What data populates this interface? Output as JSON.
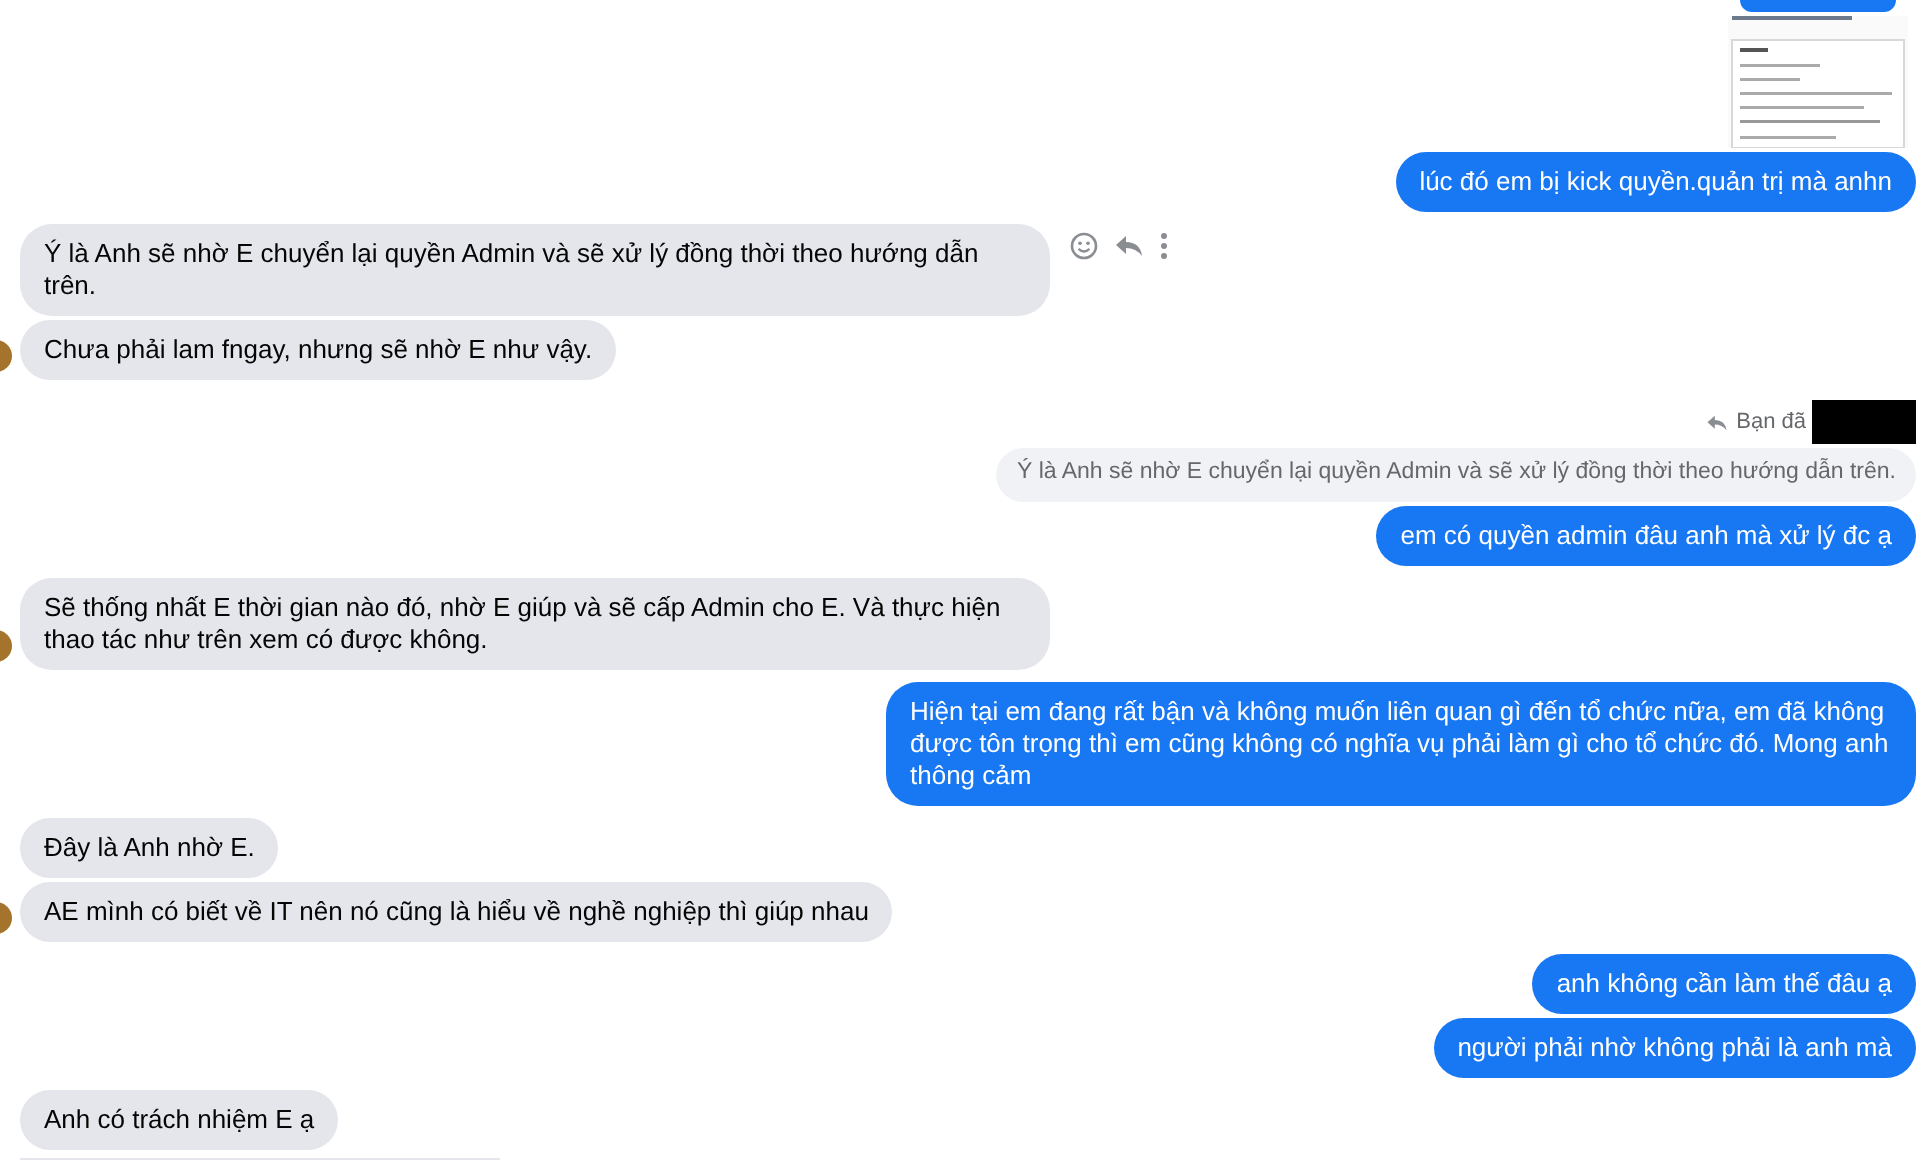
{
  "messages": [
    {
      "kind": "outgoing-cut"
    },
    {
      "kind": "attachment"
    },
    {
      "kind": "outgoing",
      "text": "lúc đó em bị kick quyền.quản trị mà anhn"
    },
    {
      "kind": "incoming",
      "text": "Ý là Anh sẽ nhờ E chuyển lại quyền Admin và sẽ xử lý đồng thời theo hướng dẫn trên.",
      "avatar": false,
      "actions": true
    },
    {
      "kind": "incoming",
      "text": "Chưa phải lam fngay, nhưng sẽ nhờ E như vậy.",
      "avatar": true,
      "actions": false
    },
    {
      "kind": "reply-label",
      "text": "Bạn đã",
      "redacted": true
    },
    {
      "kind": "quote",
      "text": "Ý là Anh sẽ nhờ E chuyển lại quyền Admin và sẽ xử lý đồng thời theo hướng dẫn trên."
    },
    {
      "kind": "outgoing",
      "text": "em có quyền admin đâu anh mà xử lý đc ạ"
    },
    {
      "kind": "incoming",
      "text": "Sẽ thống nhất E thời gian nào đó, nhờ E giúp và sẽ cấp Admin cho E. Và thực hiện thao tác như trên xem có được không.",
      "avatar": true,
      "actions": false
    },
    {
      "kind": "outgoing",
      "text": "Hiện tại em đang rất bận và không muốn liên quan gì đến tổ chức nữa, em đã không được tôn trọng thì em cũng không có nghĩa vụ phải làm gì cho tổ chức đó. Mong anh thông cảm"
    },
    {
      "kind": "incoming",
      "text": "Đây là Anh nhờ E.",
      "avatar": false,
      "actions": false
    },
    {
      "kind": "incoming",
      "text": "AE mình có biết về IT nên nó cũng là hiểu về nghề nghiệp thì giúp nhau",
      "avatar": true,
      "actions": false
    },
    {
      "kind": "outgoing",
      "text": "anh không cần làm thế đâu ạ"
    },
    {
      "kind": "outgoing",
      "text": "người phải nhờ không phải là anh mà"
    },
    {
      "kind": "incoming",
      "text": "Anh có trách nhiệm E ạ",
      "avatar": false,
      "actions": false
    }
  ]
}
